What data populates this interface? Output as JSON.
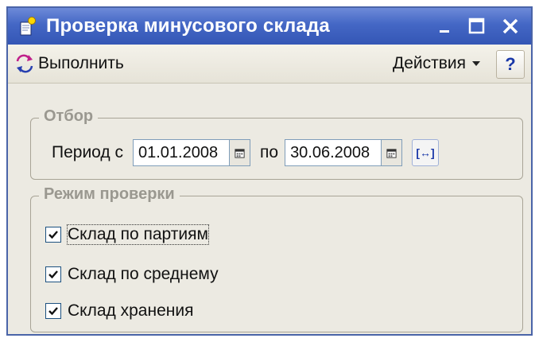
{
  "window": {
    "title": "Проверка минусового склада",
    "title_bar_color": "#4467c5"
  },
  "toolbar": {
    "run_label": "Выполнить",
    "actions_label": "Действия",
    "help_label": "?"
  },
  "filter_group": {
    "legend": "Отбор",
    "period_from_label": "Период с",
    "date_from": "01.01.2008",
    "period_to_label": "по",
    "date_to": "30.06.2008",
    "period_button_glyph": "[↔]"
  },
  "mode_group": {
    "legend": "Режим проверки",
    "options": [
      {
        "label": "Склад по партиям",
        "checked": true
      },
      {
        "label": "Склад по среднему",
        "checked": true
      },
      {
        "label": "Склад хранения",
        "checked": true
      }
    ]
  },
  "icons": {
    "app": "document-form-icon",
    "run": "execute-arrows-icon",
    "calendar": "calendar-icon",
    "minimize": "minimize-icon",
    "maximize": "maximize-icon",
    "close": "close-icon"
  }
}
